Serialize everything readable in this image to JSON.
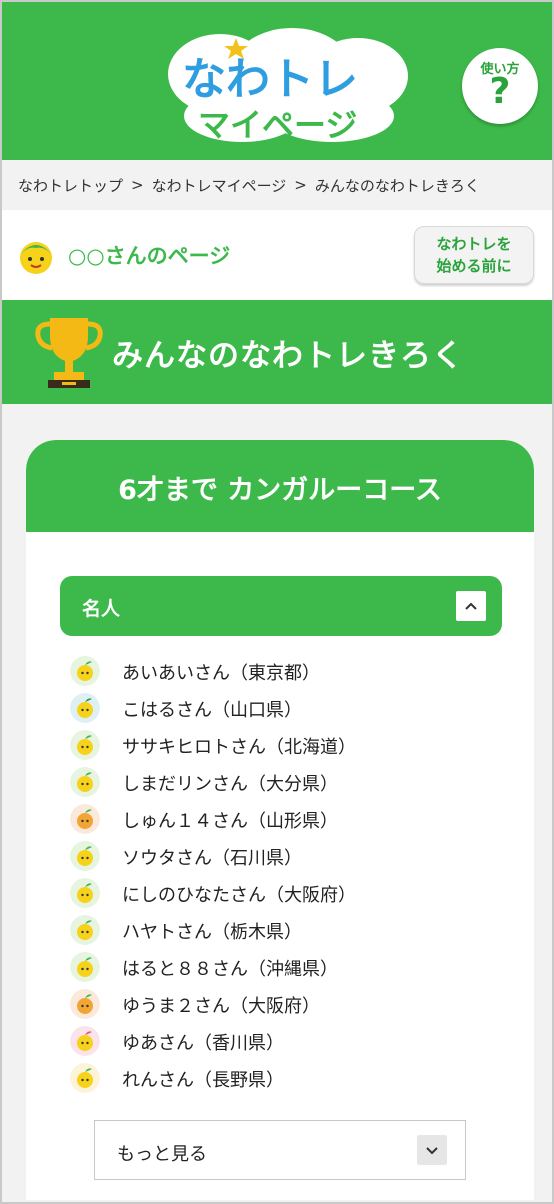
{
  "header": {
    "logo_line1": "なわトレ",
    "logo_line2": "マイページ",
    "help_label": "使い方",
    "help_mark": "?"
  },
  "breadcrumb": [
    "なわトレトップ",
    "なわトレマイページ",
    "みんなのなわトレきろく"
  ],
  "breadcrumb_separator": ">",
  "user": {
    "title": "○○さんのページ",
    "before_button": [
      "なわトレを",
      "始める前に"
    ]
  },
  "banner": {
    "title": "みんなのなわトレきろく"
  },
  "course": {
    "title": "6才まで カンガルーコース",
    "section_title": "名人",
    "entries": [
      {
        "text": "あいあいさん（東京都）",
        "avatar": "yellow-character-icon"
      },
      {
        "text": "こはるさん（山口県）",
        "avatar": "green-hair-character-icon"
      },
      {
        "text": "ササキヒロトさん（北海道）",
        "avatar": "yellow-character-icon"
      },
      {
        "text": "しまだリンさん（大分県）",
        "avatar": "yellow-character-icon"
      },
      {
        "text": "しゅん１４さん（山形県）",
        "avatar": "orange-character-icon"
      },
      {
        "text": "ソウタさん（石川県）",
        "avatar": "yellow-character-icon"
      },
      {
        "text": "にしのひなたさん（大阪府）",
        "avatar": "yellow-character-icon"
      },
      {
        "text": "ハヤトさん（栃木県）",
        "avatar": "yellow-character-icon"
      },
      {
        "text": "はると８８さん（沖縄県）",
        "avatar": "yellow-character-icon"
      },
      {
        "text": "ゆうま２さん（大阪府）",
        "avatar": "orange-character-icon"
      },
      {
        "text": "ゆあさん（香川県）",
        "avatar": "pink-character-icon"
      },
      {
        "text": "れんさん（長野県）",
        "avatar": "cheer-character-icon"
      }
    ],
    "more_label": "もっと見る"
  },
  "colors": {
    "brand_green": "#3cb94a",
    "logo_blue": "#2f9ee0",
    "logo_pink": "#e9508a",
    "logo_yellow": "#f3c21a"
  }
}
